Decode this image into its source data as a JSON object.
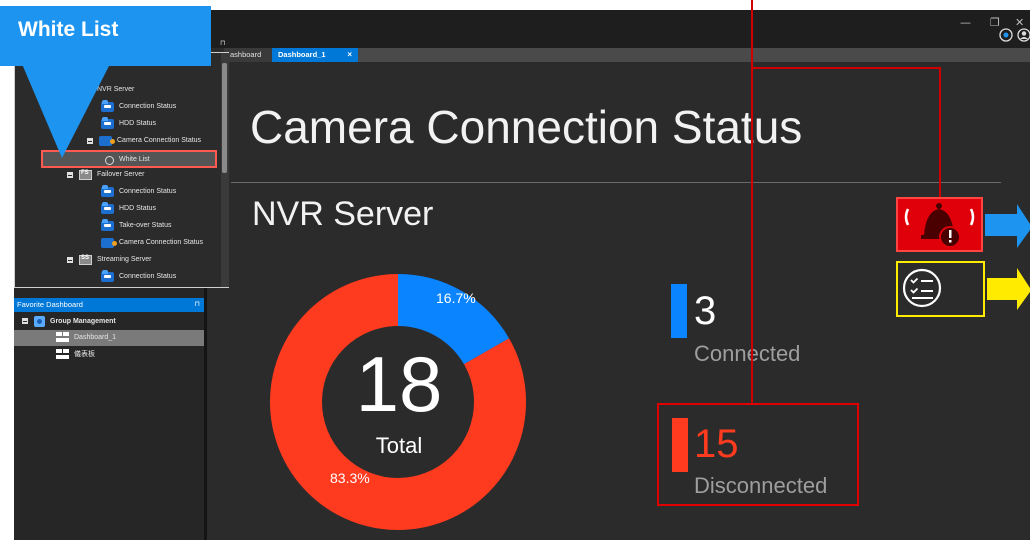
{
  "callout": {
    "title": "White List"
  },
  "tabs": [
    {
      "label": "ashboard"
    },
    {
      "label": "Dashboard_1",
      "close": "×"
    }
  ],
  "window_controls": {
    "minimize": "—",
    "restore": "❐",
    "close": "✕"
  },
  "tree": {
    "pin": "⊓",
    "items": [
      {
        "label": "NVR Server",
        "icon": "nvr-server-icon"
      },
      {
        "label": "Connection Status",
        "icon": "connection-status-icon"
      },
      {
        "label": "HDD Status",
        "icon": "hdd-status-icon"
      },
      {
        "label": "Camera Connection Status",
        "icon": "camera-connection-icon"
      },
      {
        "label": "White List",
        "icon": "globe-icon",
        "selected": true
      },
      {
        "label": "Failover Server",
        "icon": "failover-server-icon",
        "badge": "FS"
      },
      {
        "label": "Connection Status",
        "icon": "connection-status-icon"
      },
      {
        "label": "HDD Status",
        "icon": "hdd-status-icon"
      },
      {
        "label": "Take-over Status",
        "icon": "takeover-status-icon"
      },
      {
        "label": "Camera Connection Status",
        "icon": "camera-connection-icon"
      },
      {
        "label": "Streaming Server",
        "icon": "streaming-server-icon",
        "badge": "SS"
      },
      {
        "label": "Connection Status",
        "icon": "connection-status-icon"
      }
    ]
  },
  "favorite": {
    "header": "Favorite Dashboard",
    "pin": "⊓",
    "group": "Group Management",
    "items": [
      {
        "label": "Dashboard_1",
        "selected": true
      },
      {
        "label": "儀表板"
      }
    ]
  },
  "dashboard": {
    "title": "Camera Connection Status",
    "server": "NVR Server",
    "total": "18",
    "total_label": "Total",
    "connected_value": "3",
    "connected_label": "Connected",
    "disconnected_value": "15",
    "disconnected_label": "Disconnected",
    "connected_pct": "16.7%",
    "disconnected_pct": "83.3%",
    "connected_share": 16.7,
    "disconnected_share": 83.3
  },
  "colors": {
    "connected": "#0a84ff",
    "disconnected": "#ff3b1f",
    "callout": "#1d94f0",
    "highlight": "#e00000",
    "checklist_highlight": "#ffeb00"
  }
}
